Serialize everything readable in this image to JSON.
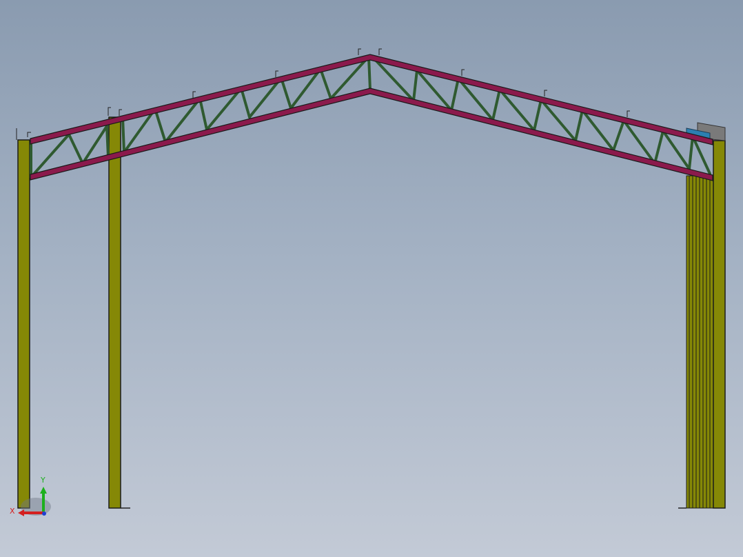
{
  "viewport": {
    "background_top": "#8a9bb0",
    "background_bottom": "#c3cad6"
  },
  "colors": {
    "column": "#858806",
    "chord": "#8b1a4c",
    "web": "#2f5a30",
    "axis_x": "#d42020",
    "axis_y": "#1db01d",
    "axis_z": "#2040d0"
  },
  "triad": {
    "x_label": "X",
    "y_label": "Y",
    "icon": "coordinate-triad-icon"
  },
  "model": {
    "name": "portal-frame-truss",
    "columns": 3,
    "truss": "gable"
  }
}
